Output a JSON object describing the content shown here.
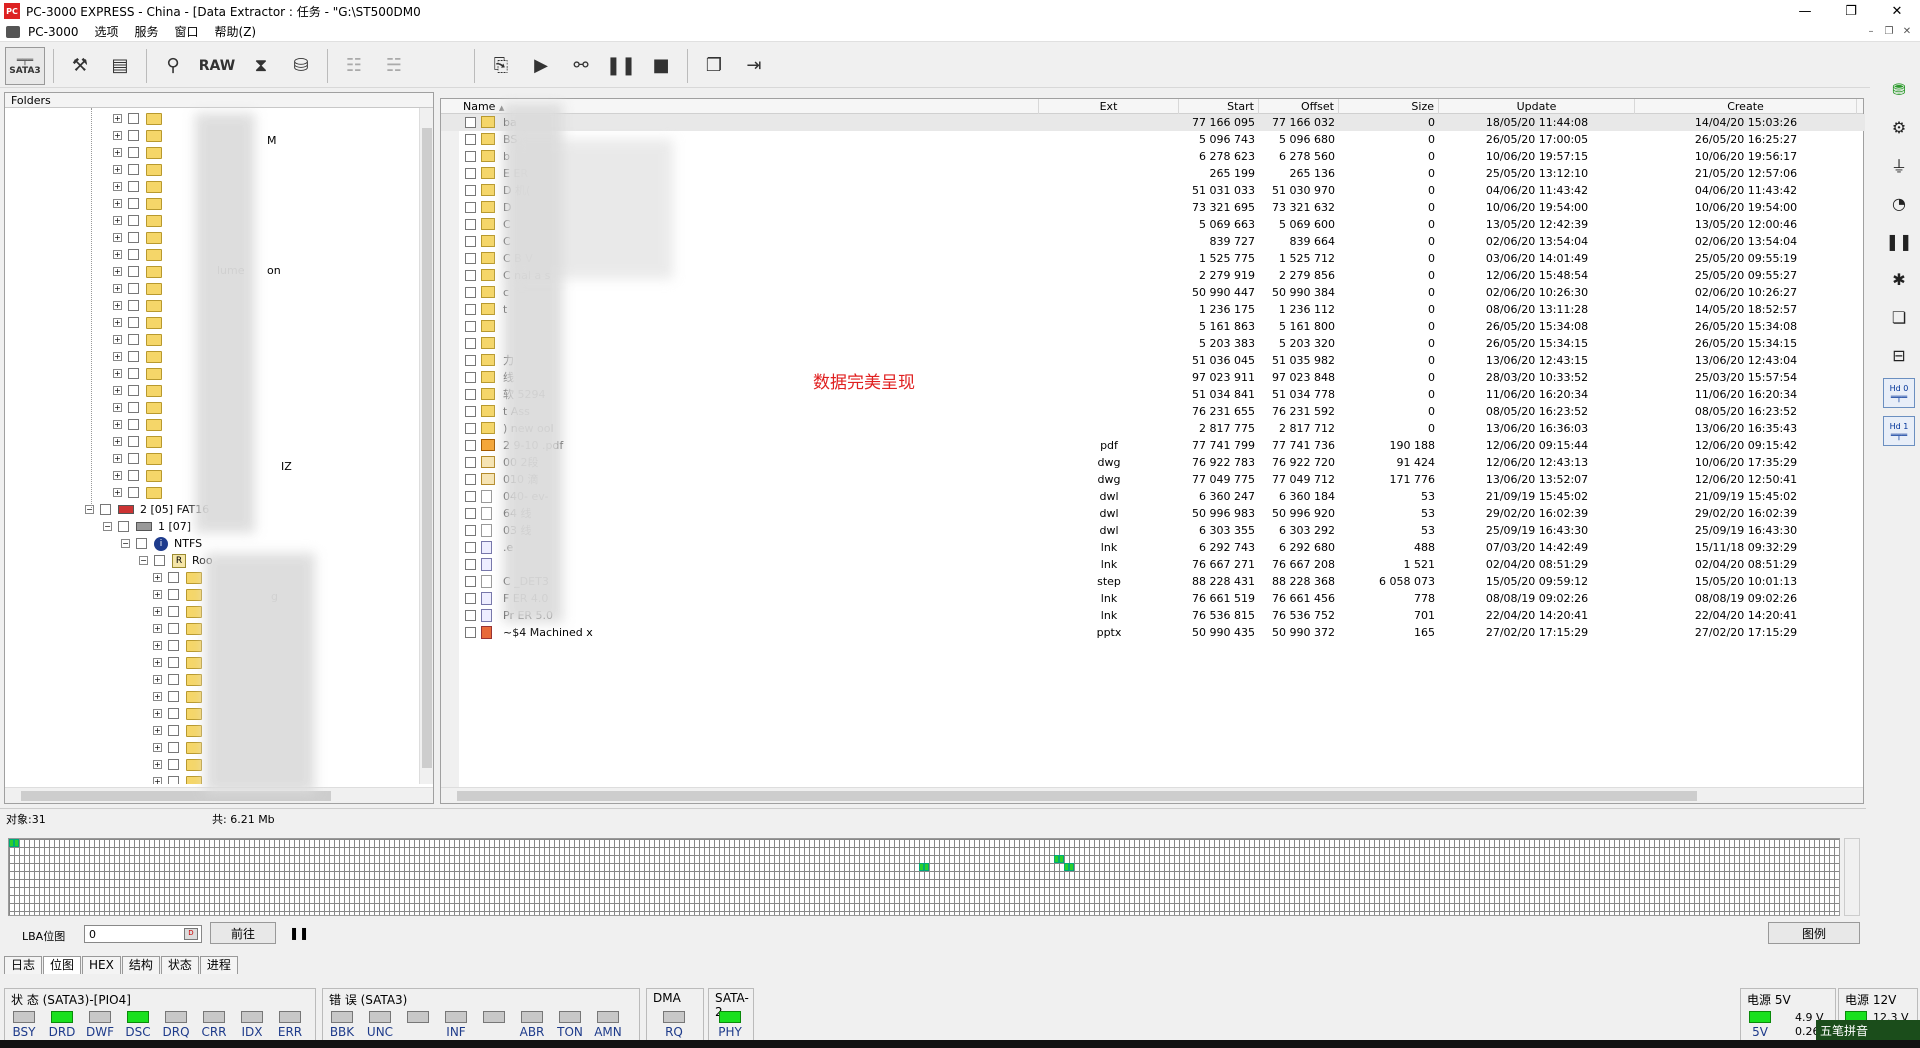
{
  "window": {
    "title": "PC-3000 EXPRESS - China - [Data Extractor : 任务 - \"G:\\ST500DM0",
    "app_icon": "PC-3000 app icon",
    "controls": [
      "—",
      "❐",
      "✕"
    ]
  },
  "menu": {
    "items": [
      "PC-3000",
      "选项",
      "服务",
      "窗口",
      "帮助(Z)"
    ],
    "mdi_controls": [
      "–",
      "❐",
      "✕"
    ]
  },
  "toolbar": {
    "sata_label": "SATA3",
    "raw_label": "RAW"
  },
  "folders_panel": {
    "header": "Folders",
    "tree": [
      {
        "level": 0,
        "label": "2 [05] FAT16",
        "icon": "partition-icon"
      },
      {
        "level": 1,
        "label": "1 [07]",
        "icon": "hdd-icon"
      },
      {
        "level": 2,
        "label": "NTFS",
        "icon": "ntfs-icon"
      },
      {
        "level": 3,
        "label": "Roo",
        "icon": "root-icon"
      }
    ],
    "visible_fragments": [
      "M",
      "lume",
      "on",
      "IZ",
      "g"
    ]
  },
  "file_list": {
    "columns": [
      "Name",
      "Ext",
      "Start",
      "Offset",
      "Size",
      "Update",
      "Create"
    ],
    "sort_indicator": "▲",
    "rows": [
      {
        "name": "ba",
        "ext": "",
        "start": "77 166 095",
        "offset": "77 166 032",
        "size": "0",
        "update": "18/05/20 11:44:08",
        "create": "14/04/20 15:03:26",
        "icon": "folder"
      },
      {
        "name": "BS",
        "ext": "",
        "start": "5 096 743",
        "offset": "5 096 680",
        "size": "0",
        "update": "26/05/20 17:00:05",
        "create": "26/05/20 16:25:27",
        "icon": "folder"
      },
      {
        "name": "b",
        "ext": "",
        "start": "6 278 623",
        "offset": "6 278 560",
        "size": "0",
        "update": "10/06/20 19:57:15",
        "create": "10/06/20 19:56:17",
        "icon": "folder"
      },
      {
        "name": "E                     ER",
        "ext": "",
        "start": "265 199",
        "offset": "265 136",
        "size": "0",
        "update": "25/05/20 13:12:10",
        "create": "21/05/20 12:57:06",
        "icon": "folder"
      },
      {
        "name": "D          机(",
        "ext": "",
        "start": "51 031 033",
        "offset": "51 030 970",
        "size": "0",
        "update": "04/06/20 11:43:42",
        "create": "04/06/20 11:43:42",
        "icon": "folder"
      },
      {
        "name": "D",
        "ext": "",
        "start": "73 321 695",
        "offset": "73 321 632",
        "size": "0",
        "update": "10/06/20 19:54:00",
        "create": "10/06/20 19:54:00",
        "icon": "folder"
      },
      {
        "name": "C",
        "ext": "",
        "start": "5 069 663",
        "offset": "5 069 600",
        "size": "0",
        "update": "13/05/20 12:42:39",
        "create": "13/05/20 12:00:46",
        "icon": "folder"
      },
      {
        "name": "C",
        "ext": "",
        "start": "839 727",
        "offset": "839 664",
        "size": "0",
        "update": "02/06/20 13:54:04",
        "create": "02/06/20 13:54:04",
        "icon": "folder"
      },
      {
        "name": "C            B V",
        "ext": "",
        "start": "1 525 775",
        "offset": "1 525 712",
        "size": "0",
        "update": "03/06/20 14:01:49",
        "create": "25/05/20 09:55:19",
        "icon": "folder"
      },
      {
        "name": "C         nal a          s",
        "ext": "",
        "start": "2 279 919",
        "offset": "2 279 856",
        "size": "0",
        "update": "12/06/20 15:48:54",
        "create": "25/05/20 09:55:27",
        "icon": "folder"
      },
      {
        "name": "c",
        "ext": "",
        "start": "50 990 447",
        "offset": "50 990 384",
        "size": "0",
        "update": "02/06/20 10:26:30",
        "create": "02/06/20 10:26:27",
        "icon": "folder"
      },
      {
        "name": "t",
        "ext": "",
        "start": "1 236 175",
        "offset": "1 236 112",
        "size": "0",
        "update": "08/06/20 13:11:28",
        "create": "14/05/20 18:52:57",
        "icon": "folder"
      },
      {
        "name": "",
        "ext": "",
        "start": "5 161 863",
        "offset": "5 161 800",
        "size": "0",
        "update": "26/05/20 15:34:08",
        "create": "26/05/20 15:34:08",
        "icon": "folder"
      },
      {
        "name": "",
        "ext": "",
        "start": "5 203 383",
        "offset": "5 203 320",
        "size": "0",
        "update": "26/05/20 15:34:15",
        "create": "26/05/20 15:34:15",
        "icon": "folder"
      },
      {
        "name": "力",
        "ext": "",
        "start": "51 036 045",
        "offset": "51 035 982",
        "size": "0",
        "update": "13/06/20 12:43:15",
        "create": "13/06/20 12:43:04",
        "icon": "folder"
      },
      {
        "name": "线",
        "ext": "",
        "start": "97 023 911",
        "offset": "97 023 848",
        "size": "0",
        "update": "28/03/20 10:33:52",
        "create": "25/03/20 15:57:54",
        "icon": "folder"
      },
      {
        "name": "软        5294",
        "ext": "",
        "start": "51 034 841",
        "offset": "51 034 778",
        "size": "0",
        "update": "11/06/20 16:20:34",
        "create": "11/06/20 16:20:34",
        "icon": "folder"
      },
      {
        "name": "           t Ass",
        "ext": "",
        "start": "76 231 655",
        "offset": "76 231 592",
        "size": "0",
        "update": "08/05/20 16:23:52",
        "create": "08/05/20 16:23:52",
        "icon": "folder"
      },
      {
        "name": "          ) new        ool",
        "ext": "",
        "start": "2 817 775",
        "offset": "2 817 712",
        "size": "0",
        "update": "13/06/20 16:36:03",
        "create": "13/06/20 16:35:43",
        "icon": "folder"
      },
      {
        "name": "2          9-10          .pdf",
        "ext": "pdf",
        "start": "77 741 799",
        "offset": "77 741 736",
        "size": "190 188",
        "update": "12/06/20 09:15:44",
        "create": "12/06/20 09:15:42",
        "icon": "pdf"
      },
      {
        "name": "00           2段",
        "ext": "dwg",
        "start": "76 922 783",
        "offset": "76 922 720",
        "size": "91 424",
        "update": "12/06/20 12:43:13",
        "create": "10/06/20 17:35:29",
        "icon": "dwg"
      },
      {
        "name": "010          滴",
        "ext": "dwg",
        "start": "77 049 775",
        "offset": "77 049 712",
        "size": "171 776",
        "update": "13/06/20 13:52:07",
        "create": "12/06/20 12:50:41",
        "icon": "dwg"
      },
      {
        "name": "040-          ev-",
        "ext": "dwl",
        "start": "6 360 247",
        "offset": "6 360 184",
        "size": "53",
        "update": "21/09/19 15:45:02",
        "create": "21/09/19 15:45:02",
        "icon": "doc"
      },
      {
        "name": "64           线",
        "ext": "dwl",
        "start": "50 996 983",
        "offset": "50 996 920",
        "size": "53",
        "update": "29/02/20 16:02:39",
        "create": "29/02/20 16:02:39",
        "icon": "doc"
      },
      {
        "name": "03           线",
        "ext": "dwl",
        "start": "6 303 355",
        "offset": "6 303 292",
        "size": "53",
        "update": "25/09/19 16:43:30",
        "create": "25/09/19 16:43:30",
        "icon": "doc"
      },
      {
        "name": ".e",
        "ext": "lnk",
        "start": "6 292 743",
        "offset": "6 292 680",
        "size": "488",
        "update": "07/03/20 14:42:49",
        "create": "15/11/18 09:32:29",
        "icon": "lnk"
      },
      {
        "name": "",
        "ext": "lnk",
        "start": "76 667 271",
        "offset": "76 667 208",
        "size": "1 521",
        "update": "02/04/20 08:51:29",
        "create": "02/04/20 08:51:29",
        "icon": "lnk"
      },
      {
        "name": "C           _DET3",
        "ext": "step",
        "start": "88 228 431",
        "offset": "88 228 368",
        "size": "6 058 073",
        "update": "15/05/20 09:59:12",
        "create": "15/05/20 10:01:13",
        "icon": "doc"
      },
      {
        "name": "F           ER 4.0",
        "ext": "lnk",
        "start": "76 661 519",
        "offset": "76 661 456",
        "size": "778",
        "update": "08/08/19 09:02:26",
        "create": "08/08/19 09:02:26",
        "icon": "lnk"
      },
      {
        "name": "Pr          ER 5.0",
        "ext": "lnk",
        "start": "76 536 815",
        "offset": "76 536 752",
        "size": "701",
        "update": "22/04/20 14:20:41",
        "create": "22/04/20 14:20:41",
        "icon": "lnk"
      },
      {
        "name": "~$4       Machined                       x",
        "ext": "pptx",
        "start": "50 990 435",
        "offset": "50 990 372",
        "size": "165",
        "update": "27/02/20 17:15:29",
        "create": "27/02/20 17:15:29",
        "icon": "pptx"
      }
    ],
    "overlay_text": "数据完美呈现"
  },
  "status_strip": {
    "objects": "对象:31",
    "total": "共: 6.21 Mb"
  },
  "lba": {
    "label": "LBA位图",
    "value": "0",
    "tag": "D",
    "go_button": "前往",
    "pause_icon": "pause-icon",
    "legend_button": "图例"
  },
  "tabs": [
    "日志",
    "位图",
    "HEX",
    "结构",
    "状态",
    "进程"
  ],
  "active_tab": "位图",
  "status_group": {
    "title": "状 态 (SATA3)-[PIO4]",
    "leds": [
      {
        "label": "BSY",
        "on": false
      },
      {
        "label": "DRD",
        "on": true
      },
      {
        "label": "DWF",
        "on": false
      },
      {
        "label": "DSC",
        "on": true
      },
      {
        "label": "DRQ",
        "on": false
      },
      {
        "label": "CRR",
        "on": false
      },
      {
        "label": "IDX",
        "on": false
      },
      {
        "label": "ERR",
        "on": false
      }
    ]
  },
  "error_group": {
    "title": "错 误 (SATA3)",
    "leds": [
      {
        "label": "BBK",
        "on": false
      },
      {
        "label": "UNC",
        "on": false
      },
      {
        "label": "",
        "on": false
      },
      {
        "label": "INF",
        "on": false
      },
      {
        "label": "",
        "on": false
      },
      {
        "label": "ABR",
        "on": false
      },
      {
        "label": "TON",
        "on": false
      },
      {
        "label": "AMN",
        "on": false
      }
    ]
  },
  "dma_group": {
    "title": "DMA",
    "led_label": "RQ",
    "on": false
  },
  "sata_group": {
    "title": "SATA-2",
    "led_label": "PHY",
    "on": true
  },
  "power5": {
    "title": "电源 5V",
    "led_label": "5V",
    "volt": "4.9 V",
    "amp": "0.26"
  },
  "power12": {
    "title": "电源 12V",
    "volt": "12.3 V"
  },
  "ime": {
    "label": "五笔拼音"
  },
  "colors": {
    "led_on": "#19e01e",
    "overlay": "#e02020",
    "folder": "#f5d669"
  }
}
